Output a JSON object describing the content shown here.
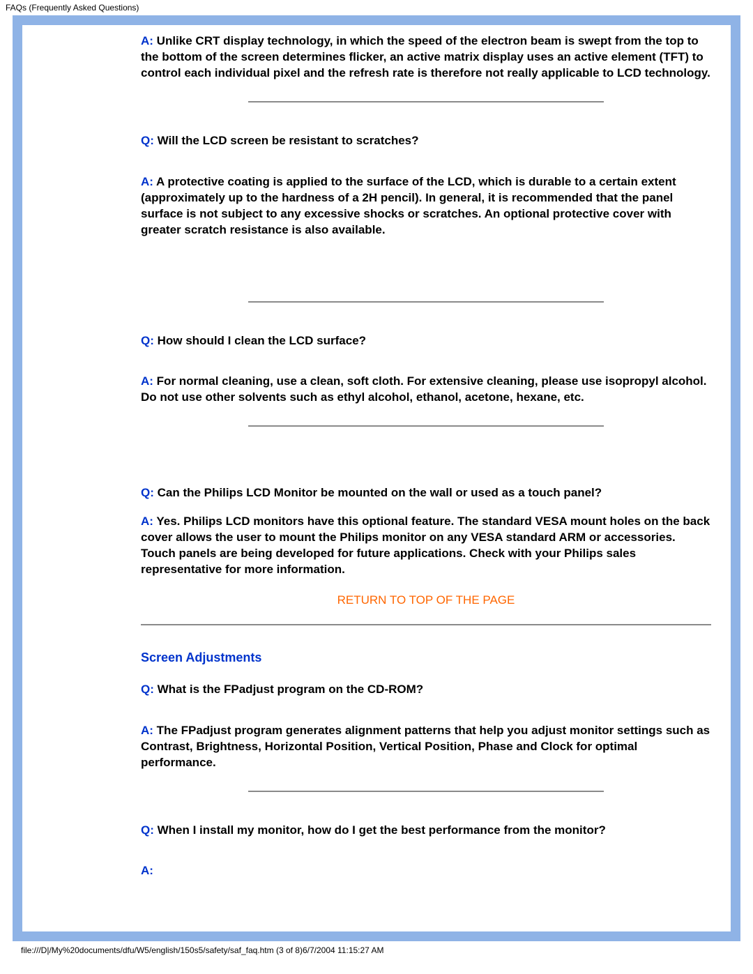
{
  "header": {
    "title": "FAQs (Frequently Asked Questions)"
  },
  "faqs": [
    {
      "a_label": "A:",
      "a_text": " Unlike CRT display technology, in which the speed of the electron beam is swept from the top to the bottom of the screen determines flicker, an active matrix display uses an active element (TFT) to control each individual pixel and the refresh rate is therefore not really applicable to LCD technology."
    },
    {
      "q_label": "Q:",
      "q_text": " Will the LCD screen be resistant to scratches?",
      "a_label": "A:",
      "a_text": " A protective coating is applied to the surface of the LCD, which is durable to a certain extent (approximately up to the hardness of a 2H pencil). In general, it is recommended that the panel surface is not subject to any excessive shocks or scratches. An optional protective cover with greater scratch resistance is also available."
    },
    {
      "q_label": "Q:",
      "q_text": " How should I clean the LCD surface?",
      "a_label": "A:",
      "a_text": " For normal cleaning, use a clean, soft cloth. For extensive cleaning, please use isopropyl alcohol. Do not use other solvents such as ethyl alcohol, ethanol, acetone, hexane, etc."
    },
    {
      "q_label": "Q:",
      "q_text": " Can the Philips LCD Monitor be mounted on the wall or used as a touch panel?",
      "a_label": "A:",
      "a_text": " Yes. Philips LCD monitors have this optional feature. The standard VESA mount holes on the back cover allows the user to mount the Philips monitor on any VESA standard ARM or accessories. Touch panels are being developed for future applications. Check with your Philips sales representative for more information."
    }
  ],
  "return_link": "RETURN TO TOP OF THE PAGE",
  "section2": {
    "title": "Screen Adjustments",
    "faqs": [
      {
        "q_label": "Q:",
        "q_text": " What is the FPadjust program on the CD-ROM?",
        "a_label": "A:",
        "a_text": " The FPadjust program generates alignment patterns that help you adjust monitor settings such as Contrast, Brightness, Horizontal Position, Vertical Position, Phase and Clock for optimal performance."
      },
      {
        "q_label": "Q:",
        "q_text": " When I install my monitor, how do I get the best performance from the monitor?",
        "a_label": "A:"
      }
    ]
  },
  "footer": {
    "path": "file:///D|/My%20documents/dfu/W5/english/150s5/safety/saf_faq.htm (3 of 8)6/7/2004 11:15:27 AM"
  }
}
